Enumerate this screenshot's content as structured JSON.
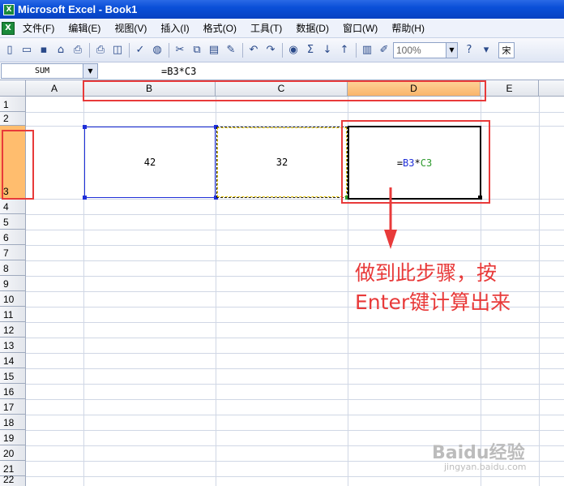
{
  "window": {
    "title": "Microsoft Excel - Book1",
    "app_icon": "X"
  },
  "menu": {
    "items": [
      "文件(F)",
      "编辑(E)",
      "视图(V)",
      "插入(I)",
      "格式(O)",
      "工具(T)",
      "数据(D)",
      "窗口(W)",
      "帮助(H)"
    ]
  },
  "toolbar": {
    "zoom": "100%",
    "font_partial": "宋"
  },
  "formula": {
    "name_box": "SUM",
    "content": "=B3*C3"
  },
  "grid": {
    "columns": [
      "A",
      "B",
      "C",
      "D",
      "E"
    ],
    "rows": [
      "1",
      "2",
      "3",
      "4",
      "5",
      "6",
      "7",
      "8",
      "9",
      "10",
      "11",
      "12",
      "13",
      "14",
      "15",
      "16",
      "17",
      "18",
      "19",
      "20",
      "21",
      "22"
    ],
    "active_column": "D",
    "active_row": "3",
    "cells": {
      "B3": "42",
      "C3": "32",
      "D3_ref1": "B3",
      "D3_op": "*",
      "D3_ref2": "C3",
      "D3_eq": "="
    }
  },
  "annotation": {
    "line1": "做到此步骤，按",
    "line2": "Enter键计算出来"
  },
  "watermark": {
    "brand": "Baidu经验",
    "url": "jingyan.baidu.com"
  },
  "colors": {
    "accent_red": "#e83a3a",
    "ref_blue": "#1f2fd8",
    "ref_green": "#2d9a2d",
    "active_header": "#ffbd6e"
  }
}
